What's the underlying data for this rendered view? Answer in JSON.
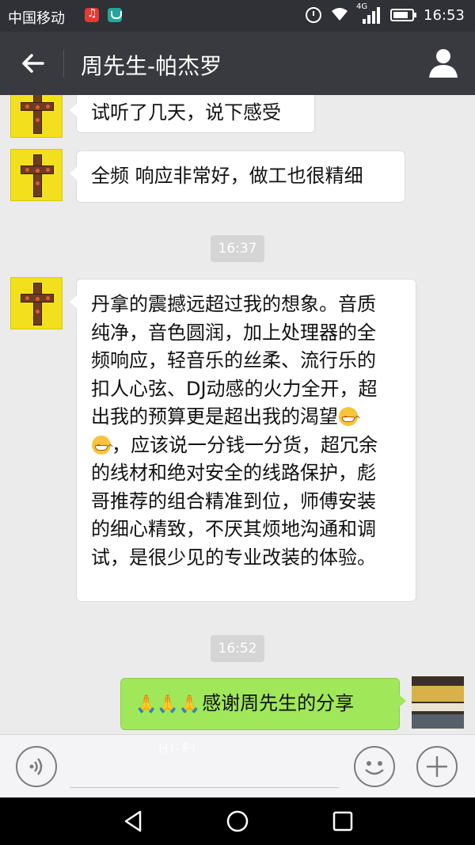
{
  "status_bar": {
    "carrier": "中国移动",
    "network": "4G",
    "time": "16:53"
  },
  "header": {
    "title": "周先生-帕杰罗",
    "back_icon": "arrow-left-icon",
    "profile_icon": "person-icon"
  },
  "messages": [
    {
      "type": "received",
      "lines": [
        "试听了几天，说下感受"
      ]
    },
    {
      "type": "received",
      "lines": [
        "全频 响应非常好，做工也很精细"
      ]
    },
    {
      "type": "time",
      "text": "16:37"
    },
    {
      "type": "received",
      "lines": [
        "丹拿的震撼远超过我的想象。音质",
        "纯净，音色圆润，加上处理器的全",
        "频响应，轻音乐的丝柔、流行乐的",
        "扣人心弦、DJ动感的火力全开，超",
        "出我的预算更是超出我的渴望",
        "，应该说一分钱一分货，超冗余",
        "的线材和绝对安全的线路保护，彪",
        "哥推荐的组合精准到位，师傅安装",
        "的细心精致，不厌其烦地沟通和调",
        "试，是很少见的专业改装的体验。"
      ]
    },
    {
      "type": "time",
      "text": "16:52"
    },
    {
      "type": "sent",
      "text": "感谢周先生的分享"
    }
  ],
  "input_bar": {
    "voice_icon": "voice-icon",
    "emoji_icon": "emoji-icon",
    "plus_icon": "plus-icon",
    "watermark": "HI-FI"
  },
  "nav_bar": {
    "back_icon": "triangle-back-icon",
    "home_icon": "circle-home-icon",
    "recents_icon": "square-recents-icon"
  },
  "colors": {
    "title_bar": "#393a3f",
    "chat_bg": "#ebebeb",
    "sent_bubble": "#a0e75a"
  }
}
